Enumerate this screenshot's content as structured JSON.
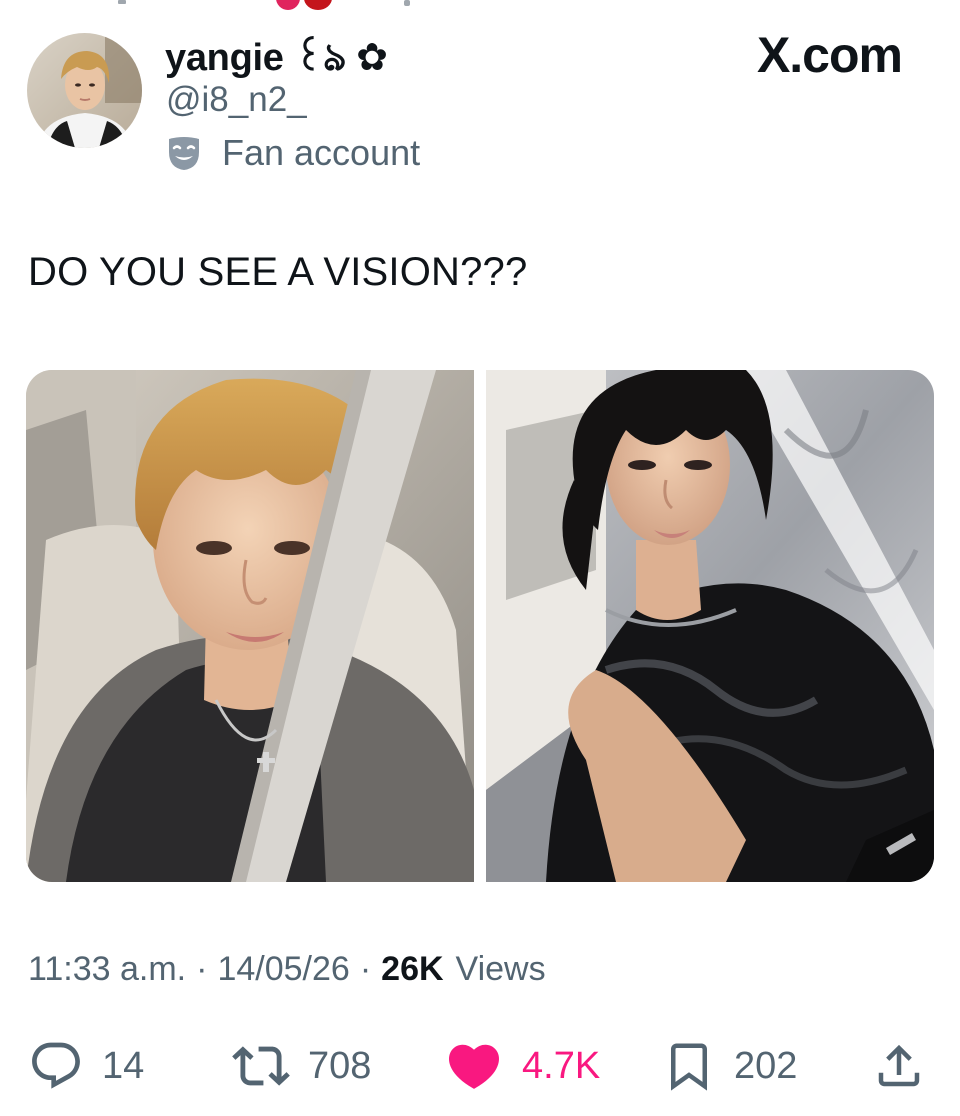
{
  "colors": {
    "text_primary": "#0f1419",
    "text_secondary": "#536471",
    "like_active": "#f91880",
    "badge_gray": "#8b98a5"
  },
  "author": {
    "display_name": "yangie ꒰ঌ ✿",
    "handle": "@i8_n2_",
    "badge_icon": "theater-mask-icon",
    "badge_label": "Fan account"
  },
  "brand": {
    "label": "X.com"
  },
  "tweet": {
    "text": "DO YOU SEE A VISION???"
  },
  "media": {
    "count": 2,
    "items": [
      "selfie-in-car",
      "mirror-selfie"
    ]
  },
  "meta": {
    "time": "11:33 a.m.",
    "date": "14/05/26",
    "views_count": "26K",
    "views_label": "Views",
    "separator": "·"
  },
  "actions": {
    "reply": {
      "icon": "reply-icon",
      "count": "14"
    },
    "retweet": {
      "icon": "retweet-icon",
      "count": "708"
    },
    "like": {
      "icon": "heart-icon",
      "count": "4.7K",
      "active": true
    },
    "bookmark": {
      "icon": "bookmark-icon",
      "count": "202"
    },
    "share": {
      "icon": "share-icon"
    }
  }
}
